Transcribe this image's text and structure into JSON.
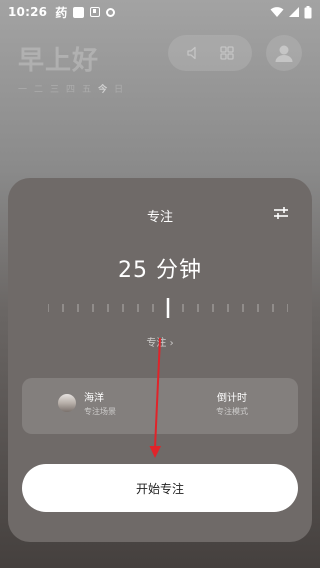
{
  "status_bar": {
    "time": "10:26",
    "app_glyph": "药",
    "icons": [
      "square-icon",
      "a-box-icon",
      "circle-icon",
      "wifi-icon",
      "signal-icon",
      "battery-icon"
    ]
  },
  "home": {
    "greeting": "早上好",
    "weekdays": [
      "一",
      "二",
      "三",
      "四",
      "五",
      "今",
      "日"
    ],
    "today_index": 5
  },
  "focus_card": {
    "title": "专注",
    "duration_text": "25 分钟",
    "duration_minutes": 25,
    "mode_link": "专注 ›",
    "scene": {
      "name": "海洋",
      "caption": "专注场景"
    },
    "timer_mode": {
      "name": "倒计时",
      "caption": "专注模式"
    },
    "start_label": "开始专注"
  },
  "colors": {
    "card_bg": "#6f6a68",
    "arrow": "#e0242a",
    "button_bg": "#ffffff"
  }
}
